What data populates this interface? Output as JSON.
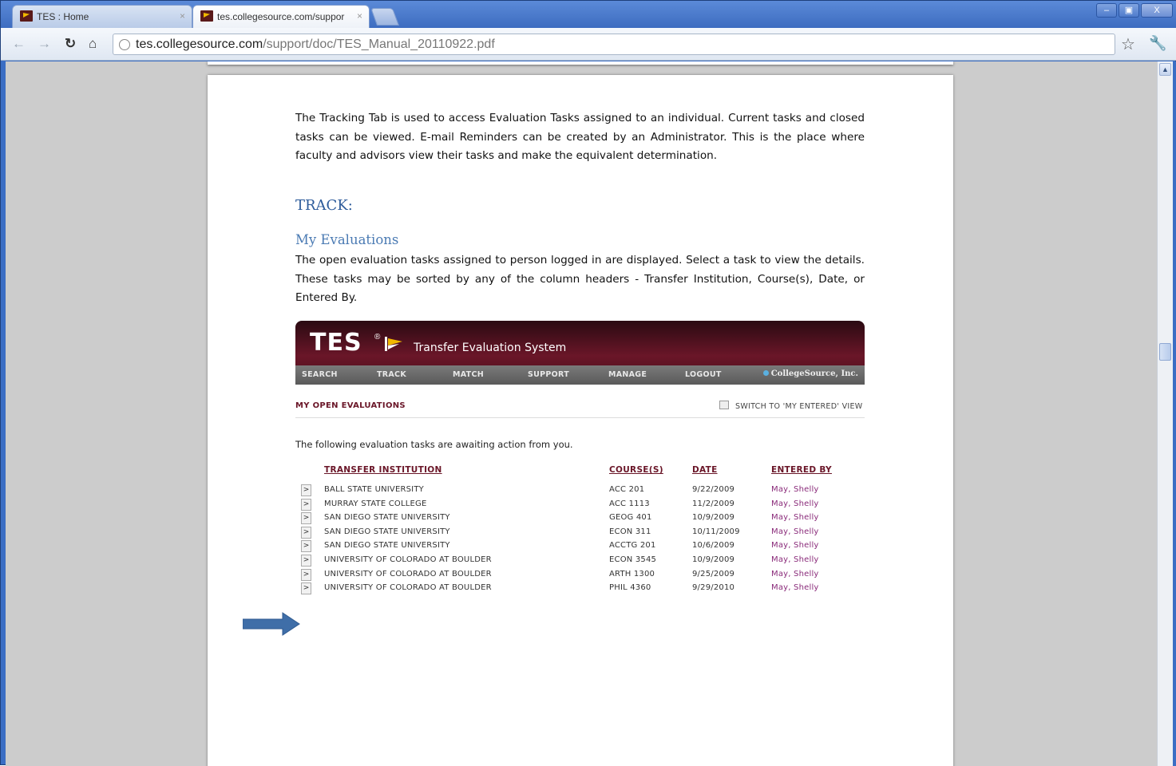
{
  "browser": {
    "tabs": [
      {
        "label": "TES : Home",
        "active": false
      },
      {
        "label": "tes.collegesource.com/suppor",
        "active": true
      }
    ],
    "url_host": "tes.collegesource.com",
    "url_path": "/support/doc/TES_Manual_20110922.pdf",
    "window_controls": [
      "–",
      "▣",
      "X"
    ]
  },
  "document": {
    "intro_paragraph": "The Tracking Tab is used to access Evaluation Tasks assigned to an individual.  Current tasks and closed tasks can be viewed.  E-mail Reminders can be created by an Administrator.  This is the place where faculty and advisors view their tasks and make the equivalent determination.",
    "heading_track": "TRACK:",
    "heading_my_evaluations": "My Evaluations",
    "evaluations_paragraph": "The open evaluation tasks assigned to person logged in are displayed.  Select a task to view the details. These tasks may be sorted by any of the column headers - Transfer Institution, Course(s), Date, or Entered By."
  },
  "tes": {
    "logo": "TES",
    "logo_mark": "®",
    "tagline": "Transfer Evaluation System",
    "nav": [
      "SEARCH",
      "TRACK",
      "MATCH",
      "SUPPORT",
      "MANAGE",
      "LOGOUT"
    ],
    "brand": "CollegeSource, Inc.",
    "section_title": "MY OPEN EVALUATIONS",
    "switch_label": "SWITCH TO 'MY ENTERED' VIEW",
    "intro": "The following evaluation tasks are awaiting action from you.",
    "columns": {
      "institution": "TRANSFER INSTITUTION",
      "course": "COURSE(S)",
      "date": "DATE",
      "entered_by": "ENTERED BY"
    },
    "go_label": ">",
    "rows": [
      {
        "institution": "BALL STATE UNIVERSITY",
        "course": "ACC 201",
        "date": "9/22/2009",
        "entered_by": "May, Shelly"
      },
      {
        "institution": "MURRAY STATE COLLEGE",
        "course": "ACC 1113",
        "date": "11/2/2009",
        "entered_by": "May, Shelly"
      },
      {
        "institution": "SAN DIEGO STATE UNIVERSITY",
        "course": "GEOG 401",
        "date": "10/9/2009",
        "entered_by": "May, Shelly"
      },
      {
        "institution": "SAN DIEGO STATE UNIVERSITY",
        "course": "ECON 311",
        "date": "10/11/2009",
        "entered_by": "May, Shelly"
      },
      {
        "institution": "SAN DIEGO STATE UNIVERSITY",
        "course": "ACCTG 201",
        "date": "10/6/2009",
        "entered_by": "May, Shelly"
      },
      {
        "institution": "UNIVERSITY OF COLORADO AT BOULDER",
        "course": "ECON 3545",
        "date": "10/9/2009",
        "entered_by": "May, Shelly"
      },
      {
        "institution": "UNIVERSITY OF COLORADO AT BOULDER",
        "course": "ARTH 1300",
        "date": "9/25/2009",
        "entered_by": "May, Shelly"
      },
      {
        "institution": "UNIVERSITY OF COLORADO AT BOULDER",
        "course": "PHIL 4360",
        "date": "9/29/2010",
        "entered_by": "May, Shelly"
      }
    ]
  },
  "colors": {
    "heading_blue": "#2e5c9b",
    "tes_maroon": "#6a1628",
    "entered_by_purple": "#8a2b7a",
    "arrow_blue": "#3f6ea8"
  }
}
